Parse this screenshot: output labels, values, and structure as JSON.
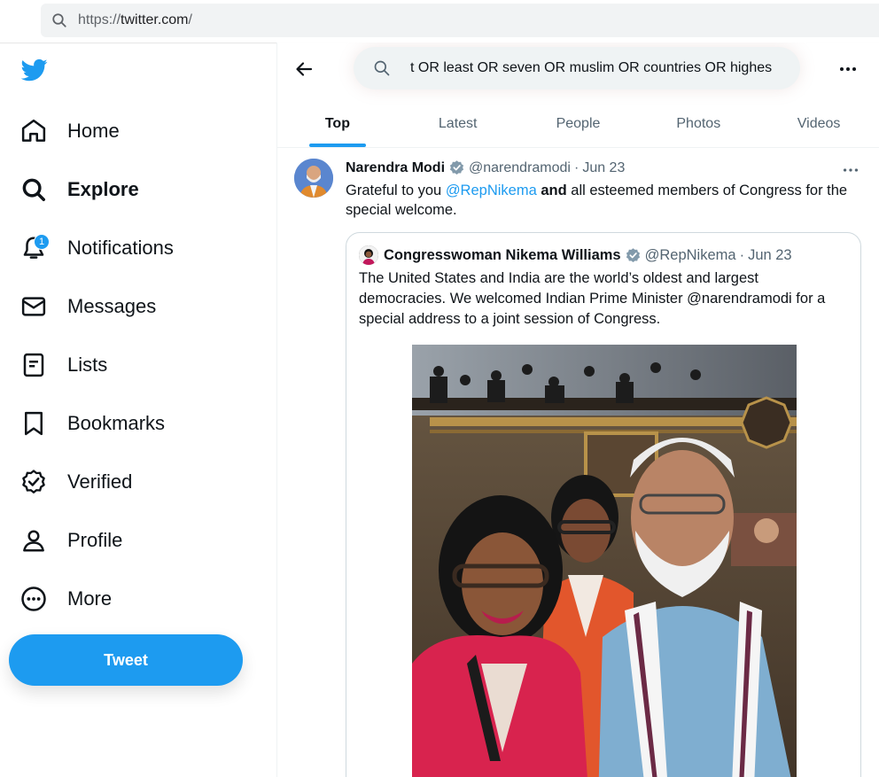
{
  "browser": {
    "url_scheme": "https://",
    "url_host": "twitter.com",
    "url_path": "/"
  },
  "sidebar": {
    "items": [
      {
        "label": "Home",
        "icon": "home-icon"
      },
      {
        "label": "Explore",
        "icon": "explore-icon"
      },
      {
        "label": "Notifications",
        "icon": "bell-icon",
        "badge": "1"
      },
      {
        "label": "Messages",
        "icon": "envelope-icon"
      },
      {
        "label": "Lists",
        "icon": "list-icon"
      },
      {
        "label": "Bookmarks",
        "icon": "bookmark-icon"
      },
      {
        "label": "Verified",
        "icon": "verified-icon"
      },
      {
        "label": "Profile",
        "icon": "person-icon"
      },
      {
        "label": "More",
        "icon": "more-circle-icon"
      }
    ],
    "tweet_button": "Tweet"
  },
  "search": {
    "value": "t OR least OR seven OR muslim OR countries OR highes"
  },
  "tabs": [
    {
      "label": "Top"
    },
    {
      "label": "Latest"
    },
    {
      "label": "People"
    },
    {
      "label": "Photos"
    },
    {
      "label": "Videos"
    }
  ],
  "tweet": {
    "name": "Narendra Modi",
    "handle": "@narendramodi",
    "separator": "·",
    "date": "Jun 23",
    "text_before": "Grateful to you ",
    "mention": "@RepNikema",
    "text_bold": "and",
    "text_after": " all esteemed members of Congress for the special welcome."
  },
  "quote": {
    "name": "Congresswoman Nikema Williams",
    "handle": "@RepNikema",
    "separator": "·",
    "date": "Jun 23",
    "text": "The United States and India are the world’s oldest and largest democracies. We welcomed Indian Prime Minister @narendramodi for a special address to a joint session of Congress."
  },
  "colors": {
    "accent": "#1d9bf0",
    "text": "#0f1419",
    "secondary": "#536471"
  }
}
